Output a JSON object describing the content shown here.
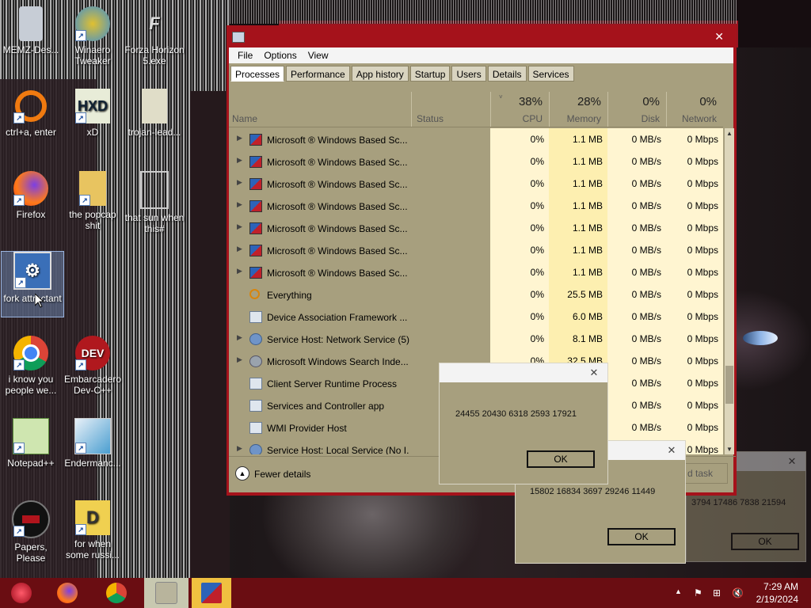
{
  "desktop": {
    "icons": [
      {
        "label": "MEMZ-Des..."
      },
      {
        "label": "Winaero Tweaker"
      },
      {
        "label": "Forza Horizon 5.exe"
      },
      {
        "label": "ctrl+a, enter"
      },
      {
        "label": "xD"
      },
      {
        "label": "trojan-lead..."
      },
      {
        "label": "Firefox"
      },
      {
        "label": "the popcap shit"
      },
      {
        "label": "that sun when this#"
      },
      {
        "label": "fork attractant"
      },
      {
        "label": "i know you people we..."
      },
      {
        "label": "Embarcadero Dev-C++"
      },
      {
        "label": "Notepad++"
      },
      {
        "label": "Endermanc..."
      },
      {
        "label": "Papers, Please"
      },
      {
        "label": "for when some russi..."
      }
    ]
  },
  "task_manager": {
    "menu": [
      "File",
      "Options",
      "View"
    ],
    "tabs": [
      "Processes",
      "Performance",
      "App history",
      "Startup",
      "Users",
      "Details",
      "Services"
    ],
    "active_tab": "Processes",
    "columns": {
      "name": "Name",
      "status": "Status",
      "cpu": {
        "pct": "38%",
        "label": "CPU"
      },
      "memory": {
        "pct": "28%",
        "label": "Memory"
      },
      "disk": {
        "pct": "0%",
        "label": "Disk"
      },
      "network": {
        "pct": "0%",
        "label": "Network"
      }
    },
    "rows": [
      {
        "name": "Microsoft ® Windows Based Sc...",
        "cpu": "0%",
        "mem": "1.1 MB",
        "disk": "0 MB/s",
        "net": "0 Mbps",
        "icon": "app-icon",
        "expand": true
      },
      {
        "name": "Microsoft ® Windows Based Sc...",
        "cpu": "0%",
        "mem": "1.1 MB",
        "disk": "0 MB/s",
        "net": "0 Mbps",
        "icon": "app-icon",
        "expand": true
      },
      {
        "name": "Microsoft ® Windows Based Sc...",
        "cpu": "0%",
        "mem": "1.1 MB",
        "disk": "0 MB/s",
        "net": "0 Mbps",
        "icon": "app-icon",
        "expand": true
      },
      {
        "name": "Microsoft ® Windows Based Sc...",
        "cpu": "0%",
        "mem": "1.1 MB",
        "disk": "0 MB/s",
        "net": "0 Mbps",
        "icon": "app-icon",
        "expand": true
      },
      {
        "name": "Microsoft ® Windows Based Sc...",
        "cpu": "0%",
        "mem": "1.1 MB",
        "disk": "0 MB/s",
        "net": "0 Mbps",
        "icon": "app-icon",
        "expand": true
      },
      {
        "name": "Microsoft ® Windows Based Sc...",
        "cpu": "0%",
        "mem": "1.1 MB",
        "disk": "0 MB/s",
        "net": "0 Mbps",
        "icon": "app-icon",
        "expand": true
      },
      {
        "name": "Microsoft ® Windows Based Sc...",
        "cpu": "0%",
        "mem": "1.1 MB",
        "disk": "0 MB/s",
        "net": "0 Mbps",
        "icon": "app-icon",
        "expand": true
      },
      {
        "name": "Everything",
        "cpu": "0%",
        "mem": "25.5 MB",
        "disk": "0 MB/s",
        "net": "0 Mbps",
        "icon": "magnifier-icon",
        "expand": false
      },
      {
        "name": "Device Association Framework ...",
        "cpu": "0%",
        "mem": "6.0 MB",
        "disk": "0 MB/s",
        "net": "0 Mbps",
        "icon": "window-icon",
        "expand": false
      },
      {
        "name": "Service Host: Network Service (5)",
        "cpu": "0%",
        "mem": "8.1 MB",
        "disk": "0 MB/s",
        "net": "0 Mbps",
        "icon": "gear-icon",
        "expand": true
      },
      {
        "name": "Microsoft Windows Search Inde...",
        "cpu": "0%",
        "mem": "32.5 MB",
        "disk": "0 MB/s",
        "net": "0 Mbps",
        "icon": "user-icon",
        "expand": true
      },
      {
        "name": "Client Server Runtime Process",
        "cpu": "",
        "mem": "",
        "disk": "0 MB/s",
        "net": "0 Mbps",
        "icon": "window-icon",
        "expand": false
      },
      {
        "name": "Services and Controller app",
        "cpu": "",
        "mem": "",
        "disk": "0 MB/s",
        "net": "0 Mbps",
        "icon": "window-icon",
        "expand": false
      },
      {
        "name": "WMI Provider Host",
        "cpu": "",
        "mem": "",
        "disk": "0 MB/s",
        "net": "0 Mbps",
        "icon": "window-icon",
        "expand": false
      },
      {
        "name": "Service Host: Local Service (No I...",
        "cpu": "",
        "mem": "",
        "disk": "0 MB/s",
        "net": "0 Mbps",
        "icon": "gear-icon",
        "expand": true
      }
    ],
    "footer": {
      "fewer_details": "Fewer details",
      "end_task": "d task"
    }
  },
  "dialogs": [
    {
      "text": "24455 20430 6318 2593 17921",
      "ok": "OK"
    },
    {
      "text": "15802 16834 3697 29246 11449",
      "ok": "OK"
    },
    {
      "text": "3794 17486 7838 21594",
      "ok": "OK"
    }
  ],
  "taskbar": {
    "clock_time": "7:29 AM",
    "clock_date": "2/19/2024"
  }
}
